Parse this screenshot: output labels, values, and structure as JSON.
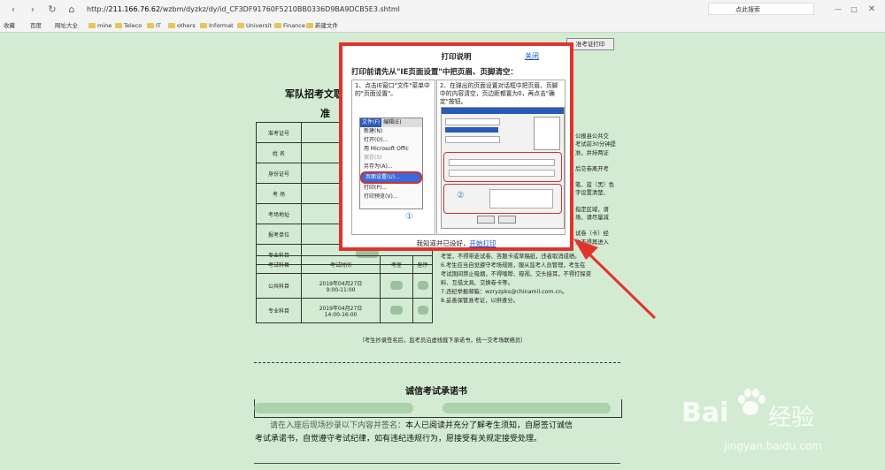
{
  "browser": {
    "url_prefix": "http://",
    "url_host": "211.166.76.62",
    "url_path": "/wzbm/dyzkz/dy/id_CF3DF91760F5210BB0336D9BA9DCB5E3.shtml",
    "search_placeholder": "点此搜索",
    "favorites": [
      "收藏",
      "百度",
      "网址大全",
      "mine",
      "Teleco",
      "IT",
      "others",
      "Informat",
      "Universit",
      "Finance",
      "新建文件"
    ]
  },
  "page": {
    "print_button": "准考证打印",
    "title_partial": "军队招考文职",
    "title_partial2": "准",
    "rows": [
      {
        "label": "准考证号"
      },
      {
        "label": "姓    名"
      },
      {
        "label": "身份证号"
      },
      {
        "label": "考    场",
        "value_partial": "学"
      },
      {
        "label": "考场地址"
      },
      {
        "label": "报考单位",
        "value_partial": "简"
      },
      {
        "label": "专业科目"
      }
    ],
    "exam_header": [
      "考试科目",
      "考试时间",
      "考室",
      "座序"
    ],
    "exam_rows": [
      {
        "subject": "公共科目",
        "date": "2019年04月27日",
        "time": "9:00-11:00"
      },
      {
        "subject": "专业科目",
        "date": "2019年04月27日",
        "time": "14:00-16:00"
      }
    ],
    "right_notes": [
      "公报县公共交",
      "考试前30分钟提",
      "准，并持两证",
      "",
      "后交卷离开考",
      "",
      "笔、蓝（黑）色",
      "字设置清楚、",
      "",
      "指定区域，请",
      "场，请尽量减",
      "",
      "试卷（卡）经",
      "生不得再进入",
      "考室，不得带走试卷、答题卡或草稿纸，违者取消成绩。",
      "6.考生应当自觉遵守考场规则，服从监考人员管理，考生在",
      "考试期间禁止吸烟，不得喧哗、窥视、交头接耳，不得打探资",
      "料、互借文具、交换卷卡等。",
      "7.违纪举报邮箱：wzryzpks@chinamil.com.cn。",
      "8.妥善保管准考证，以供查分。"
    ],
    "sign_note": "（考生抄录签名后，监考员沿虚线裁下承诺书，统一交考场联络员）",
    "pledge_title": "诚信考试承诺书",
    "pledge_text_a": "请在入座后现场抄录以下内容并签名：",
    "pledge_text_b": "本人已阅读并充分了解考生须知，自愿签订诚信",
    "pledge_text_c": "考试承诺书，自觉遵守考试纪律，如有违纪违规行为，愿接受有关规定接受处理。"
  },
  "dialog": {
    "title": "打印说明",
    "close": "关闭",
    "subtitle": "打印前请先从\"IE页面设置\"中把页眉、页脚清空：",
    "step1": "1、点击IE窗口\"文件\"菜单中的\"页面设置\"。",
    "step2": "2、在弹出的页面设置对话框中把页眉、页脚中的内容清空，页边距都置为0，再点击\"确定\"按钮。",
    "menu_header": [
      "文件(F)",
      "编辑(E)"
    ],
    "menu_items": [
      "新建(N)",
      "打开(O)...",
      "用 Microsoft Offic",
      "保存(S)",
      "另存为(A)...",
      "页面设置(U)...",
      "打印(P)...",
      "打印预览(V)..."
    ],
    "marker1": "①",
    "marker2": "②",
    "footer_text": "我知道并已设好，",
    "footer_link": "开始打印"
  },
  "watermark": {
    "brand": "Bai",
    "brand2": "经验",
    "site": "jingyan.baidu.com"
  }
}
